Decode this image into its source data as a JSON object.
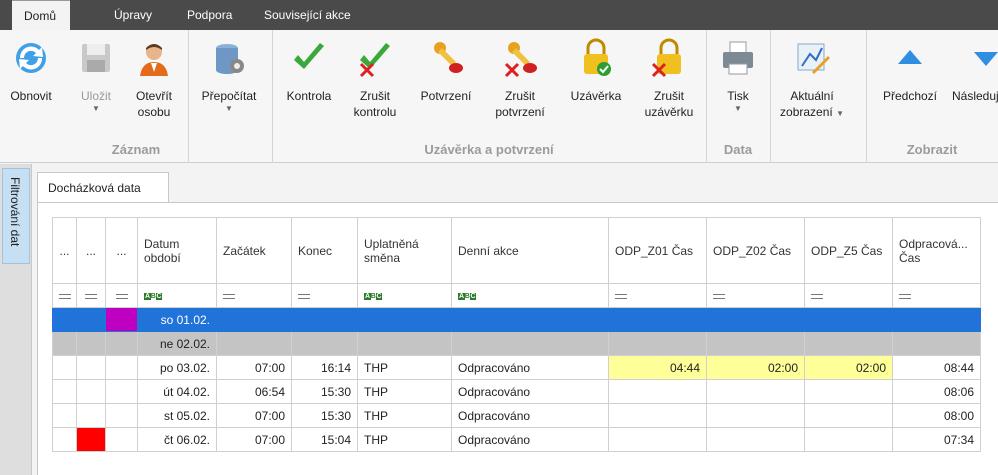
{
  "tabs": [
    "Domů",
    "Úpravy",
    "Podpora",
    "Související akce"
  ],
  "ribbon": {
    "buttons": {
      "refresh": "Obnovit",
      "save": "Uložit",
      "open_person_1": "Otevřít",
      "open_person_2": "osobu",
      "recalc": "Přepočítat",
      "check": "Kontrola",
      "cancel_check_1": "Zrušit",
      "cancel_check_2": "kontrolu",
      "confirm": "Potvrzení",
      "cancel_confirm_1": "Zrušit",
      "cancel_confirm_2": "potvrzení",
      "close": "Uzávěrka",
      "cancel_close_1": "Zrušit",
      "cancel_close_2": "uzávěrku",
      "print": "Tisk",
      "view_1": "Aktuální",
      "view_2": "zobrazení",
      "prev": "Předchozí",
      "next": "Následující"
    },
    "groups": {
      "record": "Záznam",
      "closing": "Uzávěrka a potvrzení",
      "data": "Data",
      "display": "Zobrazit"
    }
  },
  "side_panel": {
    "label": "Filtrování dat"
  },
  "doc_tab": "Docházková data",
  "grid": {
    "columns": [
      "...",
      "...",
      "...",
      "Datum období",
      "Začátek",
      "Konec",
      "Uplatněná směna",
      "Denní akce",
      "ODP_Z01 Čas",
      "ODP_Z02 Čas",
      "ODP_Z5 Čas",
      "Odpracová... Čas"
    ],
    "rows": [
      {
        "date": "so 01.02.",
        "start": "",
        "end": "",
        "shift": "",
        "action": "",
        "z01": "",
        "z02": "",
        "z5": "",
        "worked": ""
      },
      {
        "date": "ne 02.02.",
        "start": "",
        "end": "",
        "shift": "",
        "action": "",
        "z01": "",
        "z02": "",
        "z5": "",
        "worked": ""
      },
      {
        "date": "po 03.02.",
        "start": "07:00",
        "end": "16:14",
        "shift": "THP",
        "action": "Odpracováno",
        "z01": "04:44",
        "z02": "02:00",
        "z5": "02:00",
        "worked": "08:44"
      },
      {
        "date": "út 04.02.",
        "start": "06:54",
        "end": "15:30",
        "shift": "THP",
        "action": "Odpracováno",
        "z01": "",
        "z02": "",
        "z5": "",
        "worked": "08:06"
      },
      {
        "date": "st 05.02.",
        "start": "07:00",
        "end": "15:30",
        "shift": "THP",
        "action": "Odpracováno",
        "z01": "",
        "z02": "",
        "z5": "",
        "worked": "08:00"
      },
      {
        "date": "čt 06.02.",
        "start": "07:00",
        "end": "15:04",
        "shift": "THP",
        "action": "Odpracováno",
        "z01": "",
        "z02": "",
        "z5": "",
        "worked": "07:34"
      }
    ],
    "colors": {
      "selected": "#1f73d9",
      "weekend": "#c4c4c4",
      "highlight": "#ffff99",
      "mark_purple": "#c000c0",
      "mark_red": "#ff0000"
    }
  }
}
